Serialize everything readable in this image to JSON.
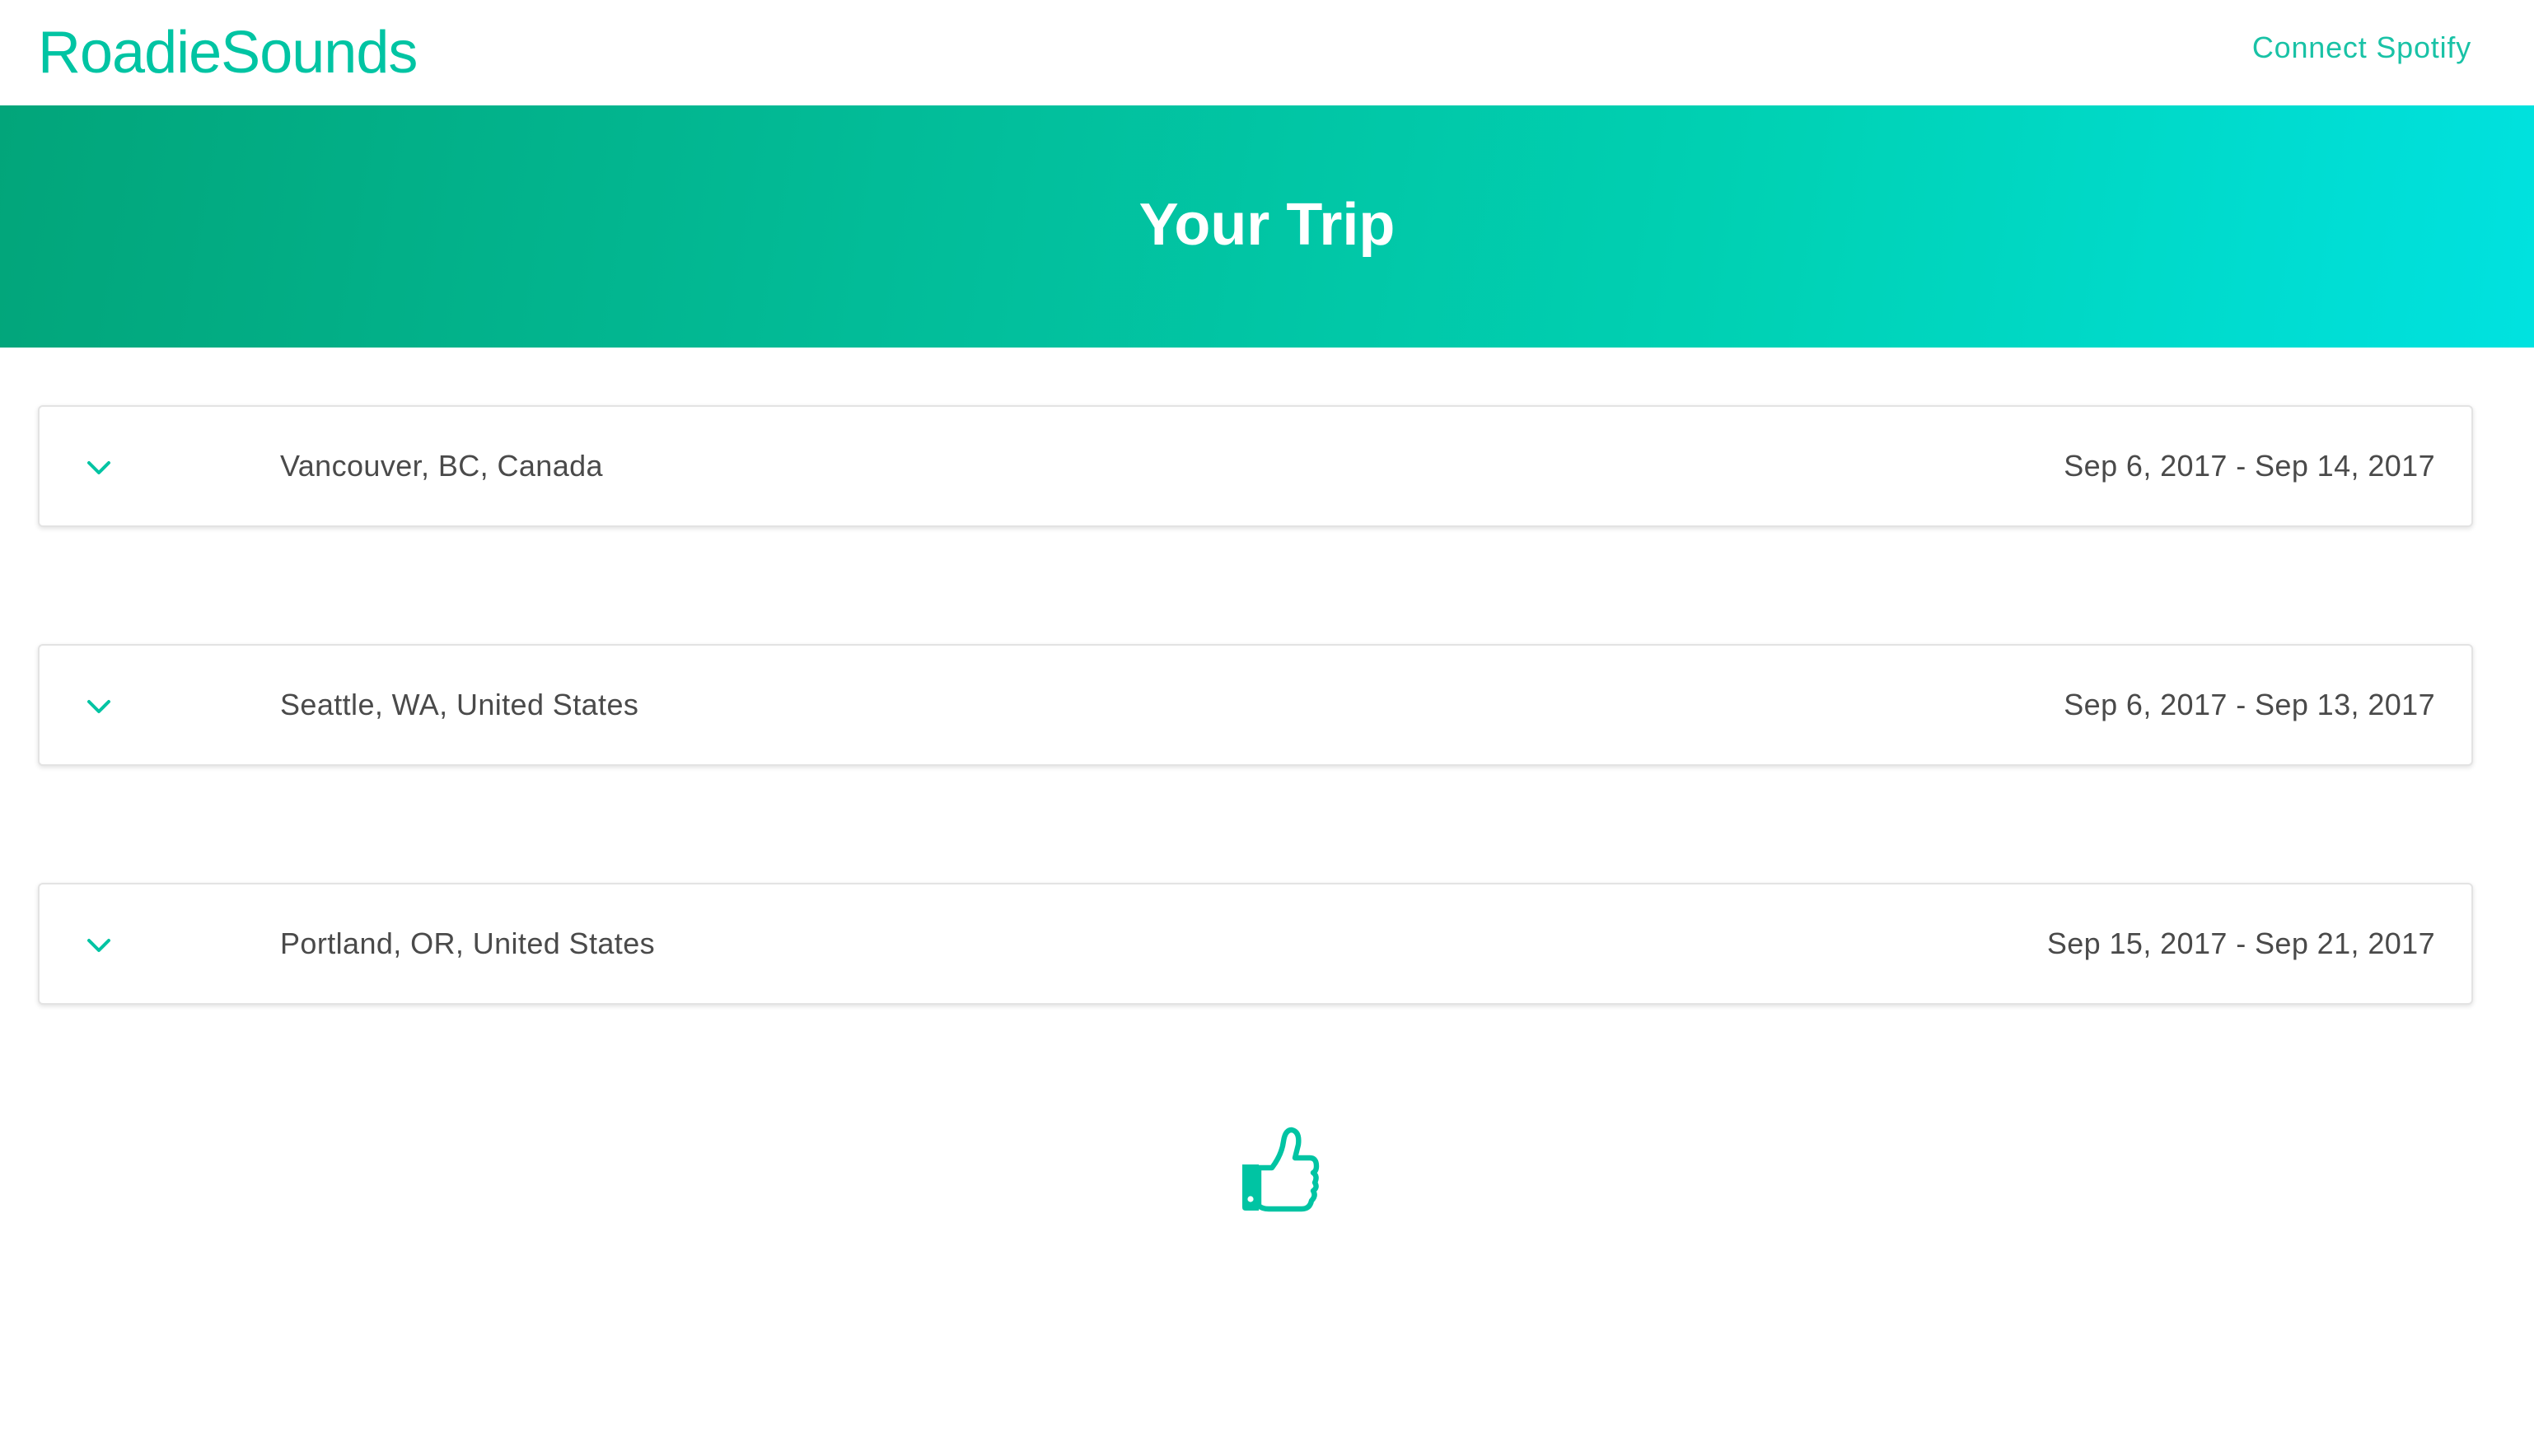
{
  "app": {
    "brand": "RoadieSounds",
    "connect_label": "Connect Spotify"
  },
  "hero": {
    "title": "Your Trip"
  },
  "trips": [
    {
      "city": "Vancouver, BC, Canada",
      "dates": "Sep 6, 2017 - Sep 14, 2017"
    },
    {
      "city": "Seattle, WA, United States",
      "dates": "Sep 6, 2017 - Sep 13, 2017"
    },
    {
      "city": "Portland, OR, United States",
      "dates": "Sep 15, 2017 - Sep 21, 2017"
    }
  ],
  "icons": {
    "expand": "chevron-down-icon",
    "confirm": "thumbs-up-icon"
  },
  "colors": {
    "accent": "#00c4a3",
    "gradient_start": "#02a57a",
    "gradient_end": "#00e2e0",
    "text": "#4a4a4a"
  }
}
